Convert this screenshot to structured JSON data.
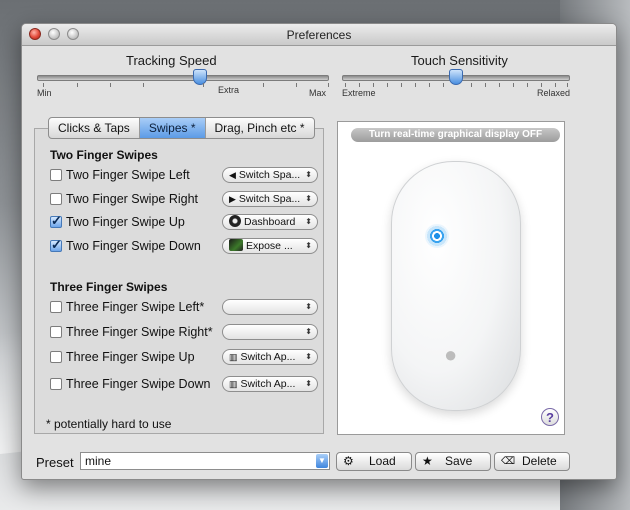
{
  "window": {
    "title": "Preferences"
  },
  "tracking": {
    "label": "Tracking Speed",
    "min": "Min",
    "extra": "Extra",
    "max": "Max",
    "value_fraction": 0.5
  },
  "touch": {
    "label": "Touch Sensitivity",
    "min": "Extreme",
    "max": "Relaxed",
    "value_fraction": 0.5
  },
  "tabs": [
    {
      "label": "Clicks & Taps",
      "active": false
    },
    {
      "label": "Swipes *",
      "active": true
    },
    {
      "label": "Drag, Pinch etc *",
      "active": false
    }
  ],
  "two_finger": {
    "heading": "Two Finger Swipes",
    "rows": [
      {
        "label": "Two Finger Swipe Left",
        "checked": false,
        "action": "Switch Spa...",
        "icon": "left-triangle-icon"
      },
      {
        "label": "Two Finger Swipe Right",
        "checked": false,
        "action": "Switch Spa...",
        "icon": "right-triangle-icon"
      },
      {
        "label": "Two Finger Swipe Up",
        "checked": true,
        "action": "Dashboard",
        "icon": "dashboard-icon"
      },
      {
        "label": "Two Finger Swipe Down",
        "checked": true,
        "action": "Expose ...",
        "icon": "expose-icon"
      }
    ]
  },
  "three_finger": {
    "heading": "Three Finger Swipes",
    "rows": [
      {
        "label": "Three Finger Swipe Left*",
        "checked": false,
        "action": ""
      },
      {
        "label": "Three Finger Swipe Right*",
        "checked": false,
        "action": ""
      },
      {
        "label": "Three Finger Swipe Up",
        "checked": false,
        "action": "Switch Ap...",
        "icon": "app-switcher-icon"
      },
      {
        "label": "Three Finger Swipe Down",
        "checked": false,
        "action": "Switch Ap...",
        "icon": "app-switcher-icon"
      }
    ]
  },
  "footnote": "* potentially hard to use",
  "display": {
    "toggle_label": "Turn real-time graphical display OFF",
    "help": "?"
  },
  "preset": {
    "label": "Preset",
    "value": "mine"
  },
  "buttons": {
    "load": "Load",
    "save": "Save",
    "delete": "Delete"
  }
}
